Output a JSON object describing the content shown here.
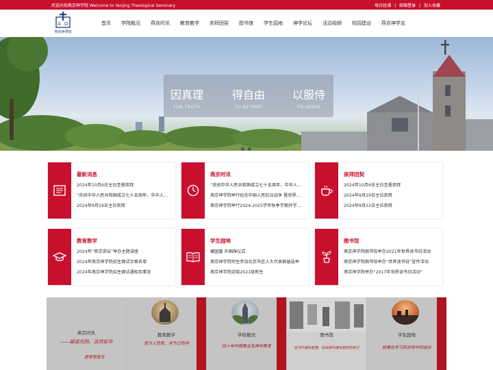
{
  "topbar": {
    "welcome": "欢迎光临燕京神学院 Welcome to Yanjing Theological Seminary",
    "links": [
      "每日经课",
      "|",
      "邮箱登录",
      "|",
      "加入收藏"
    ]
  },
  "logo": {
    "text": "燕京神學院"
  },
  "nav": [
    "首页",
    "学院概况",
    "燕京时讯",
    "教育教学",
    "崇拜团契",
    "图书馆",
    "学生园地",
    "神学论坛",
    "活动视频",
    "校园建设",
    "燕京神学志"
  ],
  "banner": {
    "motto": [
      {
        "big": "因真理",
        "small": "FOR TRUTH"
      },
      {
        "big": "得自由",
        "small": "TO BE FREE"
      },
      {
        "big": "以服侍",
        "small": "TO SERVE"
      }
    ]
  },
  "cards": [
    {
      "title": "最新消息",
      "icon": "newspaper-icon",
      "items": [
        "2024年10月6日主日圣餐崇拜",
        "“庆祝中华人民共和国成立七十五周年、中华人民共和国成立七十五周年",
        "2024年9月29日主日崇拜"
      ]
    },
    {
      "title": "燕京时讯",
      "icon": "clock-icon",
      "items": [
        "“庆祝中华人民共和国成立七十五周年、中华人民共和国成立",
        "燕京神学院举行纪念中国人民抗日战争 暨世界反法西斯战争",
        "燕京神学院举行2024-2025学年秋季学期开学典礼"
      ]
    },
    {
      "title": "崇拜团契",
      "icon": "cup-icon",
      "items": [
        "2024年10月6日主日圣餐崇拜",
        "2024年9月29日主日崇拜",
        "2024年9月22日主日崇拜"
      ]
    },
    {
      "title": "教育教学",
      "icon": "graduation-cap-icon",
      "items": [
        "2024年“燕京讲坛”举办主题讲座",
        "2024年燕京神学院招生面试合格名单",
        "2024年燕京神学院招生面试通知及事宜"
      ]
    },
    {
      "title": "学生园地",
      "icon": "book-icon",
      "items": [
        "藏园篇 升国旗仪式",
        "燕京神学院师生参加北京市区人大代表换届选举",
        "燕京神学院迎接2021级新生"
      ]
    },
    {
      "title": "图书馆",
      "icon": "plant-icon",
      "items": [
        "燕京神学院图书馆举办2021年世界读书日活动",
        "燕京神学院图书馆举办“世界读书日”宣传活动",
        "燕京神学院举办“2017年世界读书日活动”"
      ]
    }
  ],
  "gallery": [
    {
      "label": "燕京时讯",
      "calligraphy": "——细读光阴、淡然如华",
      "sub": "愿常恩爱生"
    },
    {
      "label": "教育教学",
      "calligraphy": "育为人而育，学为己而学",
      "sub": ""
    },
    {
      "label": "学校概况",
      "calligraphy": "四十年中国教会及神学教育",
      "sub": ""
    },
    {
      "label": "图书馆",
      "calligraphy": "在书中遇见智慧，在阅读中遇见更好的自己",
      "sub": ""
    },
    {
      "label": "学生园地",
      "calligraphy": "规模在学习和灵修中的成长",
      "sub": ""
    }
  ],
  "colors": {
    "accent": "#c8102e"
  }
}
